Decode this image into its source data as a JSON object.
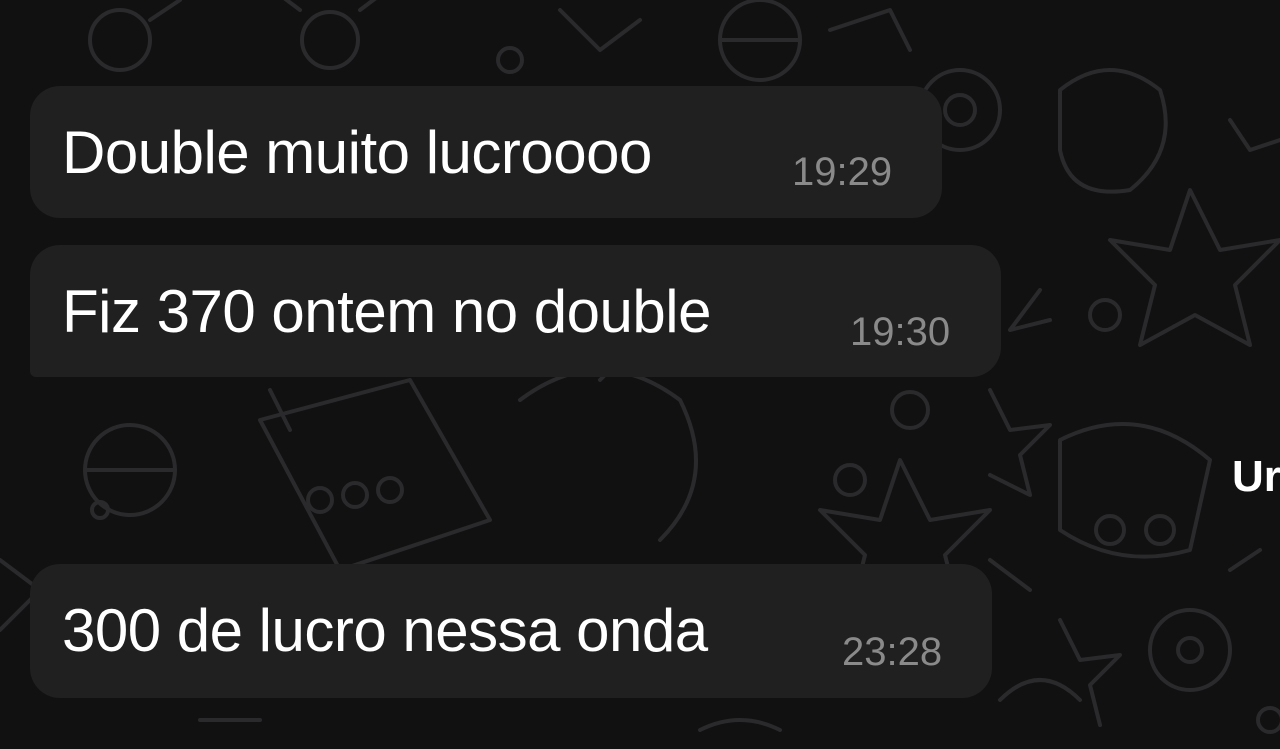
{
  "messages": [
    {
      "text": "Double muito lucroooo",
      "time": "19:29"
    },
    {
      "text": "Fiz 370 ontem no double",
      "time": "19:30"
    },
    {
      "text": "300 de lucro nessa onda",
      "time": "23:28"
    }
  ],
  "side_label": "Ur",
  "colors": {
    "background": "#111112",
    "bubble": "#202021",
    "text": "#ffffff",
    "time": "#8a8a8b",
    "doodle": "#2a2a2c"
  },
  "icons": [
    "chat-doodle-wallpaper-icon"
  ]
}
